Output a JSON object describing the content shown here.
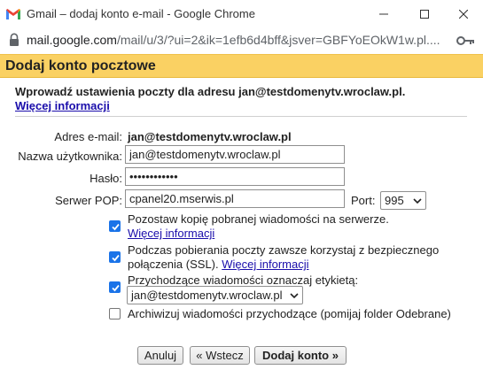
{
  "window": {
    "title": "Gmail – dodaj konto e-mail - Google Chrome",
    "url_host": "mail.google.com",
    "url_rest": "/mail/u/3/?ui=2&ik=1efb6d4bff&jsver=GBFYoEOkW1w.pl....",
    "controls": {
      "minimize": "–",
      "maximize": "☐",
      "close": "✕"
    }
  },
  "dialog": {
    "title": "Dodaj konto pocztowe",
    "intro": "Wprowadź ustawienia poczty dla adresu jan@testdomenytv.wroclaw.pl.",
    "more_info_link": "Więcej informacji"
  },
  "form": {
    "email_label": "Adres e-mail:",
    "email_value": "jan@testdomenytv.wroclaw.pl",
    "username_label": "Nazwa użytkownika:",
    "username_value": "jan@testdomenytv.wroclaw.pl",
    "password_label": "Hasło:",
    "password_value": "••••••••••••",
    "server_label": "Serwer POP:",
    "server_value": "cpanel20.mserwis.pl",
    "port_label": "Port:",
    "port_value": "995"
  },
  "options": {
    "keep_copy": {
      "checked": true,
      "text": "Pozostaw kopię pobranej wiadomości na serwerze.",
      "link": "Więcej informacji"
    },
    "ssl": {
      "checked": true,
      "text_line1": "Podczas pobierania poczty zawsze korzystaj z bezpiecznego",
      "text_line2": "połączenia (SSL).",
      "link": "Więcej informacji"
    },
    "label_incoming": {
      "checked": true,
      "text": "Przychodzące wiadomości oznaczaj etykietą:",
      "selected_label": "jan@testdomenytv.wroclaw.pl"
    },
    "archive": {
      "checked": false,
      "text": "Archiwizuj wiadomości przychodzące (pomijaj folder Odebrane)"
    }
  },
  "buttons": {
    "cancel": "Anuluj",
    "back": "« Wstecz",
    "add": "Dodaj konto »"
  },
  "colors": {
    "header_bg": "#fad163",
    "checkbox_on": "#1a73e8",
    "link": "#1a0dab"
  }
}
